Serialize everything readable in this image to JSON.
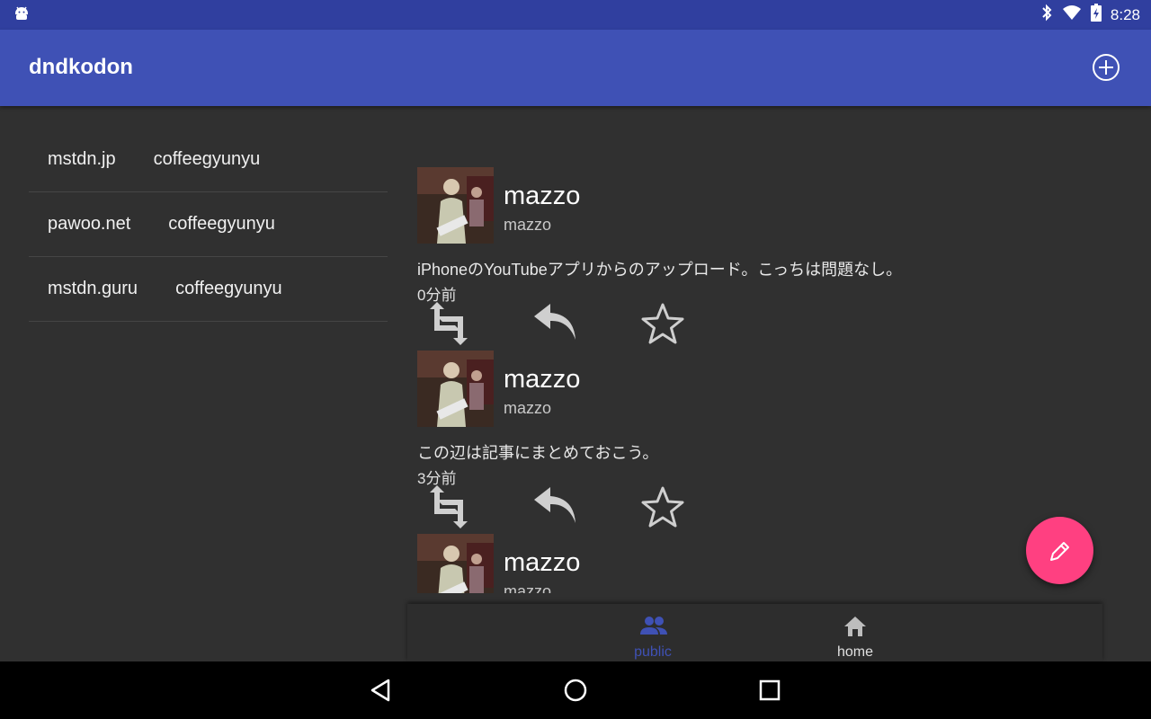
{
  "status_bar": {
    "time": "8:28",
    "icons": [
      "android-icon",
      "bluetooth-icon",
      "wifi-icon",
      "battery-charging-icon"
    ]
  },
  "app_bar": {
    "title": "dndkodon",
    "action_icon": "add-circle-icon"
  },
  "accounts": [
    {
      "instance": "mstdn.jp",
      "user": "coffeegyunyu"
    },
    {
      "instance": "pawoo.net",
      "user": "coffeegyunyu"
    },
    {
      "instance": "mstdn.guru",
      "user": "coffeegyunyu"
    }
  ],
  "toots": [
    {
      "display_name": "mazzo",
      "username": "mazzo",
      "content": "iPhoneのYouTubeアプリからのアップロード。こっちは問題なし。",
      "time": "0分前"
    },
    {
      "display_name": "mazzo",
      "username": "mazzo",
      "content": "この辺は記事にまとめておこう。",
      "time": "3分前"
    },
    {
      "display_name": "mazzo",
      "username": "mazzo",
      "content": "",
      "time": ""
    }
  ],
  "toot_actions": [
    "boost-icon",
    "reply-icon",
    "favourite-star-icon"
  ],
  "fab": {
    "icon": "pencil-icon"
  },
  "bottom_nav": {
    "items": [
      {
        "label": "public",
        "icon": "people-icon",
        "active": true
      },
      {
        "label": "home",
        "icon": "home-icon",
        "active": false
      }
    ],
    "active_color": "#3F51B5",
    "inactive_color": "#BDBDBD"
  },
  "colors": {
    "primary": "#3F51B5",
    "primary_dark": "#303F9F",
    "accent": "#FF4081",
    "background": "#303030"
  }
}
